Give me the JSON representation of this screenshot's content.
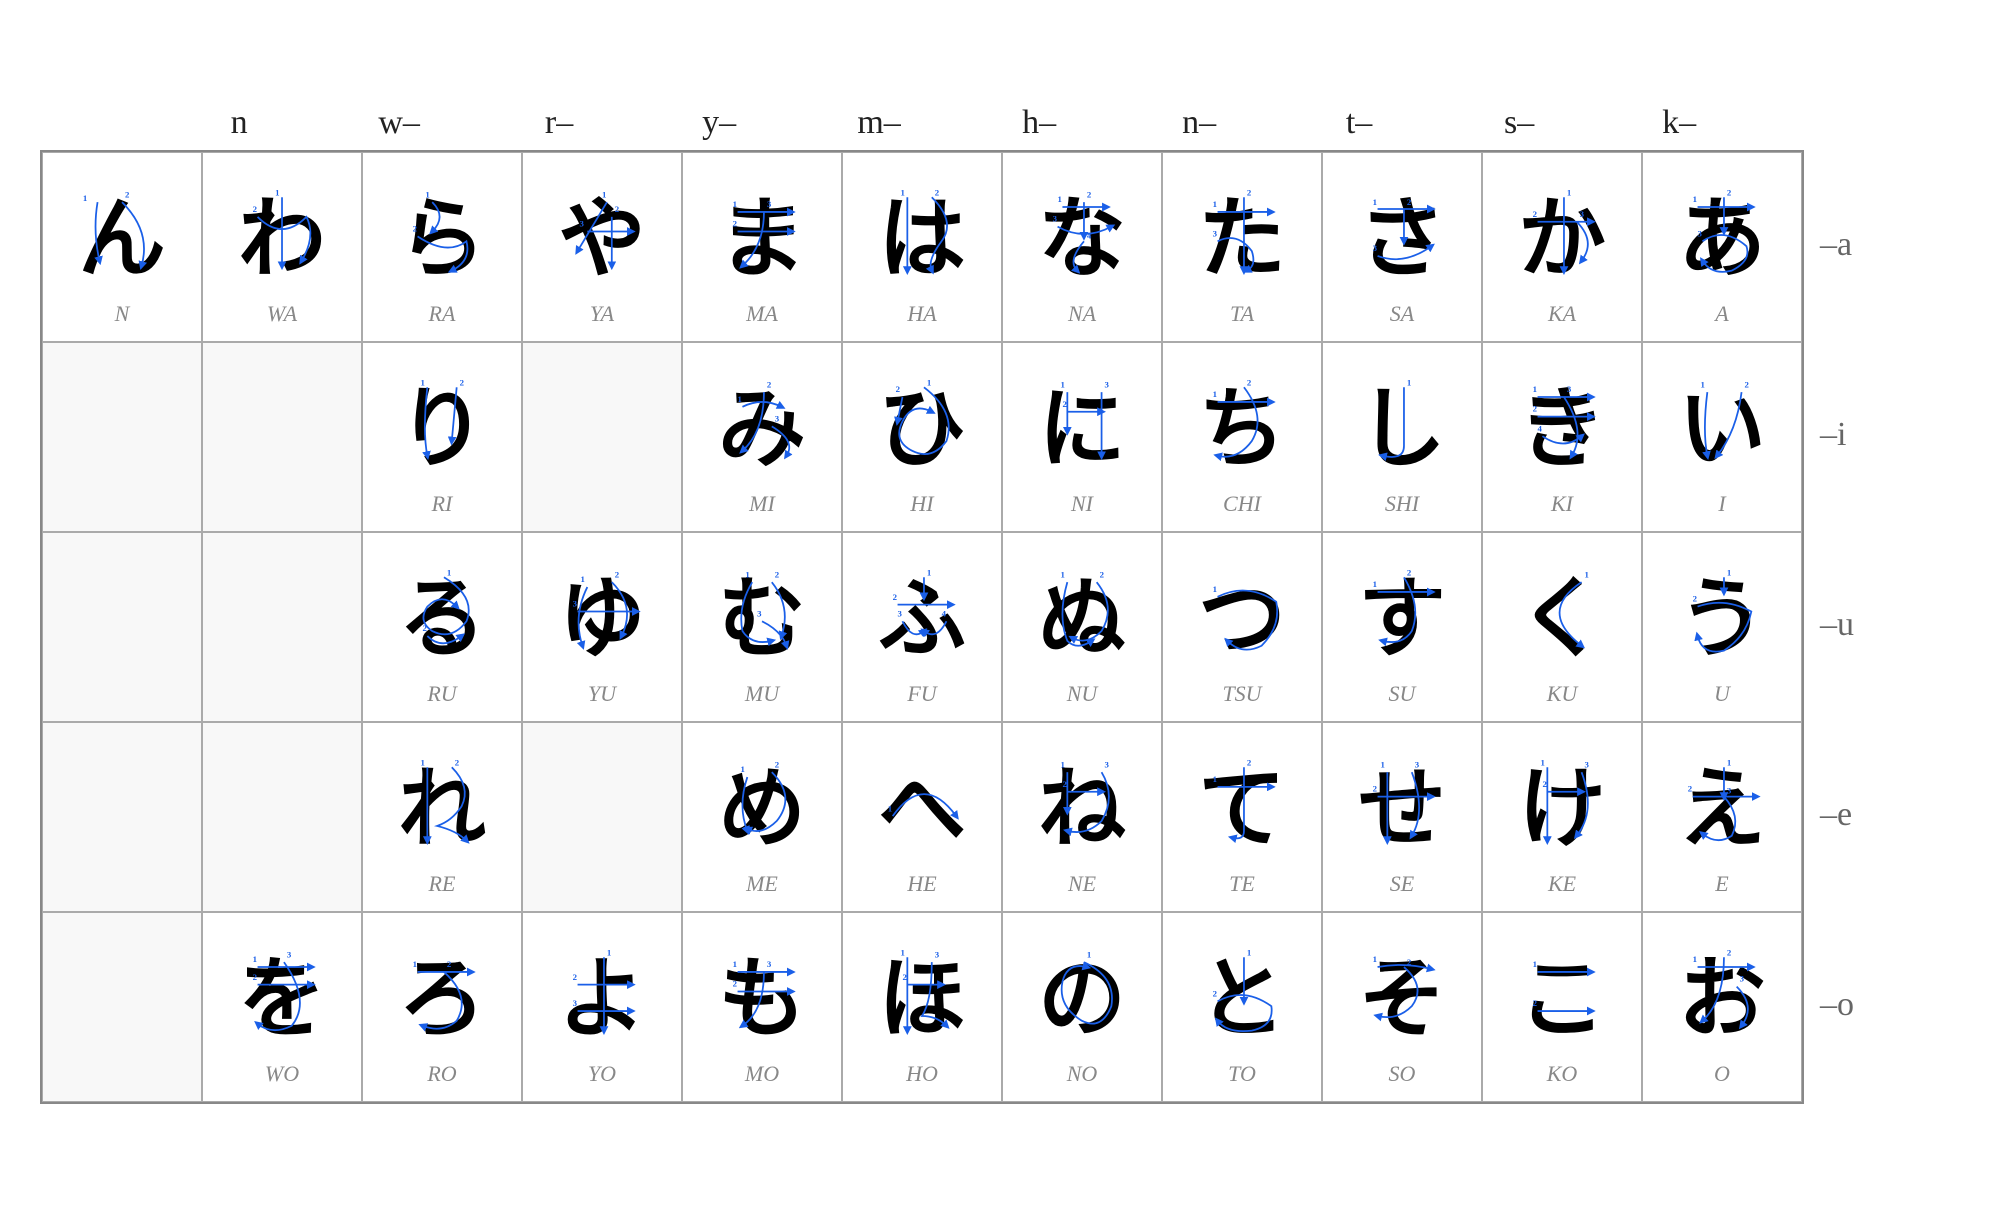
{
  "columns": {
    "headers": [
      "n",
      "w–",
      "r–",
      "y–",
      "m–",
      "h–",
      "n–",
      "t–",
      "s–",
      "k–",
      ""
    ]
  },
  "rows": {
    "labels": [
      "–a",
      "–i",
      "–u",
      "–e",
      "–o"
    ]
  },
  "cells": [
    [
      {
        "kana": "ん",
        "romaji": "N",
        "empty": false
      },
      {
        "kana": "わ",
        "romaji": "WA",
        "empty": false
      },
      {
        "kana": "ら",
        "romaji": "RA",
        "empty": false
      },
      {
        "kana": "や",
        "romaji": "YA",
        "empty": false
      },
      {
        "kana": "ま",
        "romaji": "MA",
        "empty": false
      },
      {
        "kana": "は",
        "romaji": "HA",
        "empty": false
      },
      {
        "kana": "な",
        "romaji": "NA",
        "empty": false
      },
      {
        "kana": "た",
        "romaji": "TA",
        "empty": false
      },
      {
        "kana": "さ",
        "romaji": "SA",
        "empty": false
      },
      {
        "kana": "か",
        "romaji": "KA",
        "empty": false
      },
      {
        "kana": "あ",
        "romaji": "A",
        "empty": false
      }
    ],
    [
      {
        "kana": "",
        "romaji": "",
        "empty": true
      },
      {
        "kana": "",
        "romaji": "",
        "empty": true
      },
      {
        "kana": "り",
        "romaji": "RI",
        "empty": false
      },
      {
        "kana": "",
        "romaji": "",
        "empty": true
      },
      {
        "kana": "み",
        "romaji": "MI",
        "empty": false
      },
      {
        "kana": "ひ",
        "romaji": "HI",
        "empty": false
      },
      {
        "kana": "に",
        "romaji": "NI",
        "empty": false
      },
      {
        "kana": "ち",
        "romaji": "CHI",
        "empty": false
      },
      {
        "kana": "し",
        "romaji": "SHI",
        "empty": false
      },
      {
        "kana": "き",
        "romaji": "KI",
        "empty": false
      },
      {
        "kana": "い",
        "romaji": "I",
        "empty": false
      }
    ],
    [
      {
        "kana": "",
        "romaji": "",
        "empty": true
      },
      {
        "kana": "",
        "romaji": "",
        "empty": true
      },
      {
        "kana": "る",
        "romaji": "RU",
        "empty": false
      },
      {
        "kana": "ゆ",
        "romaji": "YU",
        "empty": false
      },
      {
        "kana": "む",
        "romaji": "MU",
        "empty": false
      },
      {
        "kana": "ふ",
        "romaji": "FU",
        "empty": false
      },
      {
        "kana": "ぬ",
        "romaji": "NU",
        "empty": false
      },
      {
        "kana": "つ",
        "romaji": "TSU",
        "empty": false
      },
      {
        "kana": "す",
        "romaji": "SU",
        "empty": false
      },
      {
        "kana": "く",
        "romaji": "KU",
        "empty": false
      },
      {
        "kana": "う",
        "romaji": "U",
        "empty": false
      }
    ],
    [
      {
        "kana": "",
        "romaji": "",
        "empty": true
      },
      {
        "kana": "",
        "romaji": "",
        "empty": true
      },
      {
        "kana": "れ",
        "romaji": "RE",
        "empty": false
      },
      {
        "kana": "",
        "romaji": "",
        "empty": true
      },
      {
        "kana": "め",
        "romaji": "ME",
        "empty": false
      },
      {
        "kana": "へ",
        "romaji": "HE",
        "empty": false
      },
      {
        "kana": "ね",
        "romaji": "NE",
        "empty": false
      },
      {
        "kana": "て",
        "romaji": "TE",
        "empty": false
      },
      {
        "kana": "せ",
        "romaji": "SE",
        "empty": false
      },
      {
        "kana": "け",
        "romaji": "KE",
        "empty": false
      },
      {
        "kana": "え",
        "romaji": "E",
        "empty": false
      }
    ],
    [
      {
        "kana": "",
        "romaji": "",
        "empty": true
      },
      {
        "kana": "を",
        "romaji": "WO",
        "empty": false
      },
      {
        "kana": "ろ",
        "romaji": "RO",
        "empty": false
      },
      {
        "kana": "よ",
        "romaji": "YO",
        "empty": false
      },
      {
        "kana": "も",
        "romaji": "MO",
        "empty": false
      },
      {
        "kana": "ほ",
        "romaji": "HO",
        "empty": false
      },
      {
        "kana": "の",
        "romaji": "NO",
        "empty": false
      },
      {
        "kana": "と",
        "romaji": "TO",
        "empty": false
      },
      {
        "kana": "そ",
        "romaji": "SO",
        "empty": false
      },
      {
        "kana": "こ",
        "romaji": "KO",
        "empty": false
      },
      {
        "kana": "お",
        "romaji": "O",
        "empty": false
      }
    ]
  ],
  "arrowColor": "#1a5fe8"
}
